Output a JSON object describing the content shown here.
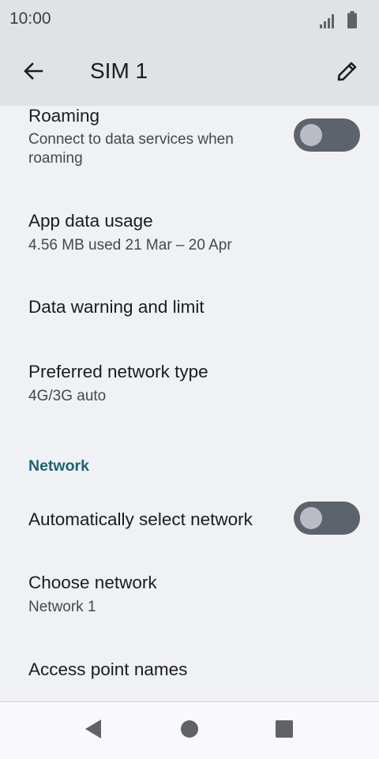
{
  "status_bar": {
    "time": "10:00",
    "icons": [
      "signal-icon",
      "battery-icon"
    ]
  },
  "app_bar": {
    "title": "SIM 1",
    "back_icon": "arrow-back-icon",
    "edit_icon": "pencil-icon"
  },
  "settings": {
    "roaming": {
      "title": "Roaming",
      "subtitle_line1": "Connect to data services when",
      "subtitle_line2": "roaming",
      "toggle_on": false
    },
    "app_data_usage": {
      "title": "App data usage",
      "subtitle": "4.56 MB used 21 Mar – 20 Apr"
    },
    "data_warning": {
      "title": "Data warning and limit"
    },
    "preferred_network": {
      "title": "Preferred network type",
      "subtitle": "4G/3G auto"
    },
    "network_section": {
      "header": "Network"
    },
    "auto_select_network": {
      "title": "Automatically select network",
      "toggle_on": false
    },
    "choose_network": {
      "title": "Choose network",
      "subtitle": "Network 1"
    },
    "access_point_names": {
      "title": "Access point names"
    }
  },
  "nav_bar": {
    "back": "triangle-back-icon",
    "home": "circle-home-icon",
    "recents": "square-recents-icon"
  },
  "colors": {
    "background": "#eff1f5",
    "app_bar": "#e1e2e6",
    "accent": "#1e6374",
    "toggle_track_off": "#5c636c",
    "toggle_thumb_off": "#b9bdc3"
  }
}
